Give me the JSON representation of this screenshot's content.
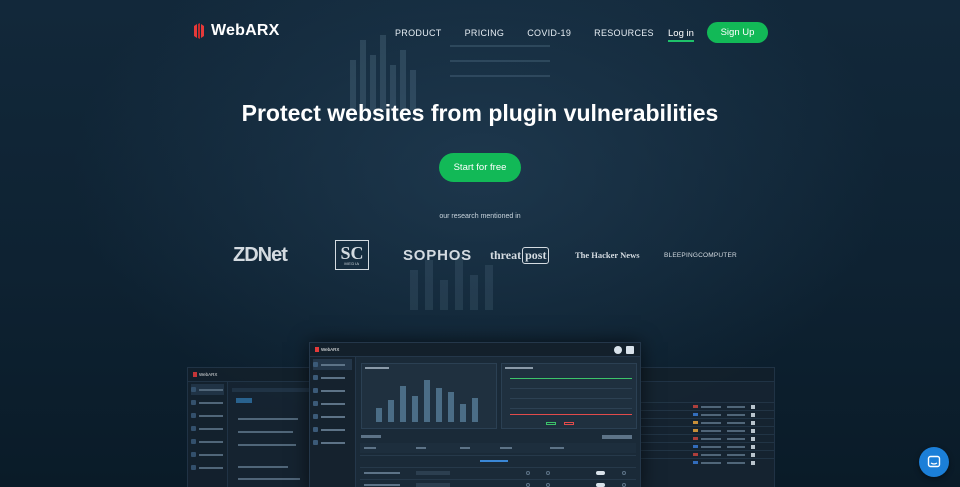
{
  "header": {
    "brand": "WebARX",
    "nav": [
      "PRODUCT",
      "PRICING",
      "COVID-19",
      "RESOURCES"
    ],
    "login": "Log in",
    "signup": "Sign Up"
  },
  "hero": {
    "title": "Protect websites from plugin vulnerabilities",
    "cta": "Start for free",
    "mentioned": "our research mentioned in"
  },
  "press": {
    "zdnet": "ZDNet",
    "sc_big": "SC",
    "sc_small": "MEDIA",
    "sophos": "SOPHOS",
    "threat": "threat",
    "post": "post",
    "hacker": "The Hacker News",
    "bleeping": "BLEEPINGCOMPUTER"
  },
  "dashboard": {
    "brand": "WebARX"
  },
  "colors": {
    "accent": "#12b957",
    "brand_red": "#e53a3a",
    "chat": "#1b7fd8",
    "background": "#0b1e2d"
  },
  "icons": {
    "logo": "webarx-logo-icon",
    "chat": "chat-bubble-icon"
  }
}
